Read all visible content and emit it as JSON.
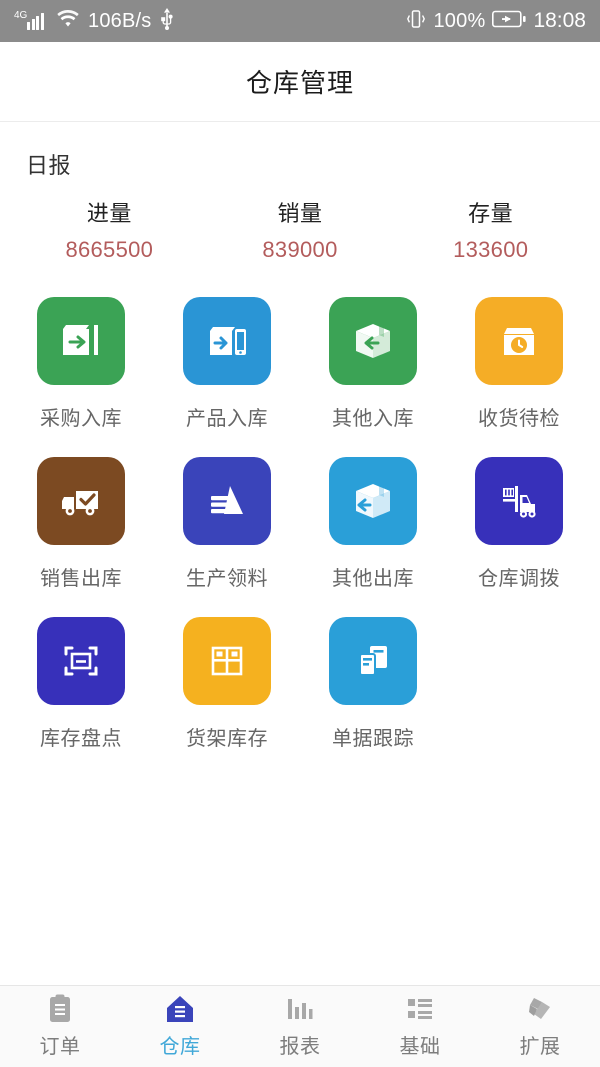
{
  "status_bar": {
    "network_type": "4G",
    "speed": "106B/s",
    "usb_icon": "usb-icon",
    "vibrate_icon": "vibrate-icon",
    "battery_percent": "100%",
    "battery_icon": "battery-charging-icon",
    "time": "18:08"
  },
  "header": {
    "title": "仓库管理"
  },
  "report": {
    "section_label": "日报",
    "value_color": "#b35c5c",
    "stats": [
      {
        "name": "进量",
        "value": "8665500"
      },
      {
        "name": "销量",
        "value": "839000"
      },
      {
        "name": "存量",
        "value": "133600"
      }
    ]
  },
  "grid": {
    "rows": [
      [
        {
          "label": "采购入库",
          "icon": "box-arrow-right-icon",
          "color": "#3ba355"
        },
        {
          "label": "产品入库",
          "icon": "box-device-arrow-icon",
          "color": "#2a95d5"
        },
        {
          "label": "其他入库",
          "icon": "parcel-arrow-in-icon",
          "color": "#3ba355"
        },
        {
          "label": "收货待检",
          "icon": "crate-clock-icon",
          "color": "#f5ad26"
        }
      ],
      [
        {
          "label": "销售出库",
          "icon": "truck-check-icon",
          "color": "#7c4a22"
        },
        {
          "label": "生产领料",
          "icon": "material-stack-icon",
          "color": "#3a44ba"
        },
        {
          "label": "其他出库",
          "icon": "parcel-arrow-out-icon",
          "color": "#2a9fd8"
        },
        {
          "label": "仓库调拨",
          "icon": "forklift-icon",
          "color": "#3730ba"
        }
      ],
      [
        {
          "label": "库存盘点",
          "icon": "scan-count-icon",
          "color": "#3730ba"
        },
        {
          "label": "货架库存",
          "icon": "shelf-grid-icon",
          "color": "#f5b11f"
        },
        {
          "label": "单据跟踪",
          "icon": "documents-track-icon",
          "color": "#2a9fd8"
        }
      ]
    ]
  },
  "bottom_nav": {
    "active_color": "#41a8d8",
    "items": [
      {
        "label": "订单",
        "icon": "clipboard-icon",
        "active": false
      },
      {
        "label": "仓库",
        "icon": "warehouse-home-icon",
        "active": true
      },
      {
        "label": "报表",
        "icon": "bar-chart-icon",
        "active": false
      },
      {
        "label": "基础",
        "icon": "list-grid-icon",
        "active": false
      },
      {
        "label": "扩展",
        "icon": "puzzle-extend-icon",
        "active": false
      }
    ]
  }
}
